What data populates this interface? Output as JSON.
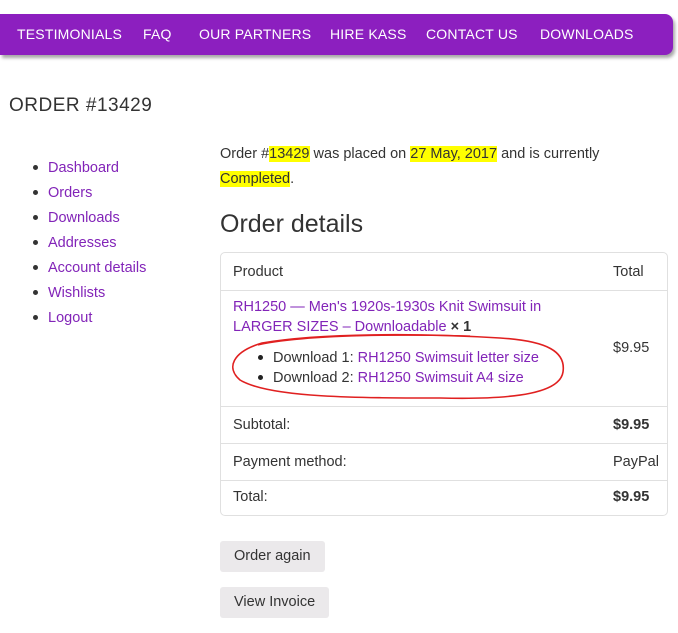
{
  "nav": {
    "items": [
      "TESTIMONIALS",
      "FAQ",
      "OUR PARTNERS",
      "HIRE KASS",
      "CONTACT US",
      "DOWNLOADS"
    ]
  },
  "page_title": "ORDER #13429",
  "account_nav": [
    "Dashboard",
    "Orders",
    "Downloads",
    "Addresses",
    "Account details",
    "Wishlists",
    "Logout"
  ],
  "notice": {
    "prefix": "Order #",
    "order_number": "13429",
    "mid1": " was placed on ",
    "date": "27 May, 2017",
    "mid2": " and is currently ",
    "status": "Completed",
    "suffix": "."
  },
  "order_details": {
    "title": "Order details",
    "col_product": "Product",
    "col_total": "Total",
    "product_name": "RH1250 — Men's 1920s-1930s Knit Swimsuit in LARGER SIZES – Downloadable",
    "quantity": "× 1",
    "product_total": "$9.95",
    "downloads": [
      {
        "label": "Download 1:",
        "link": "RH1250 Swimsuit letter size"
      },
      {
        "label": "Download 2:",
        "link": "RH1250 Swimsuit A4 size"
      }
    ],
    "subtotal_label": "Subtotal:",
    "subtotal_value": "$9.95",
    "payment_label": "Payment method:",
    "payment_value": "PayPal",
    "total_label": "Total:",
    "total_value": "$9.95"
  },
  "buttons": {
    "order_again": "Order again",
    "view_invoice": "View Invoice"
  },
  "colors": {
    "nav_bg": "#8c1fbf",
    "link": "#8224b8",
    "highlight": "#ffff00",
    "annotation": "#e02020",
    "button_bg": "#ebe9eb"
  }
}
